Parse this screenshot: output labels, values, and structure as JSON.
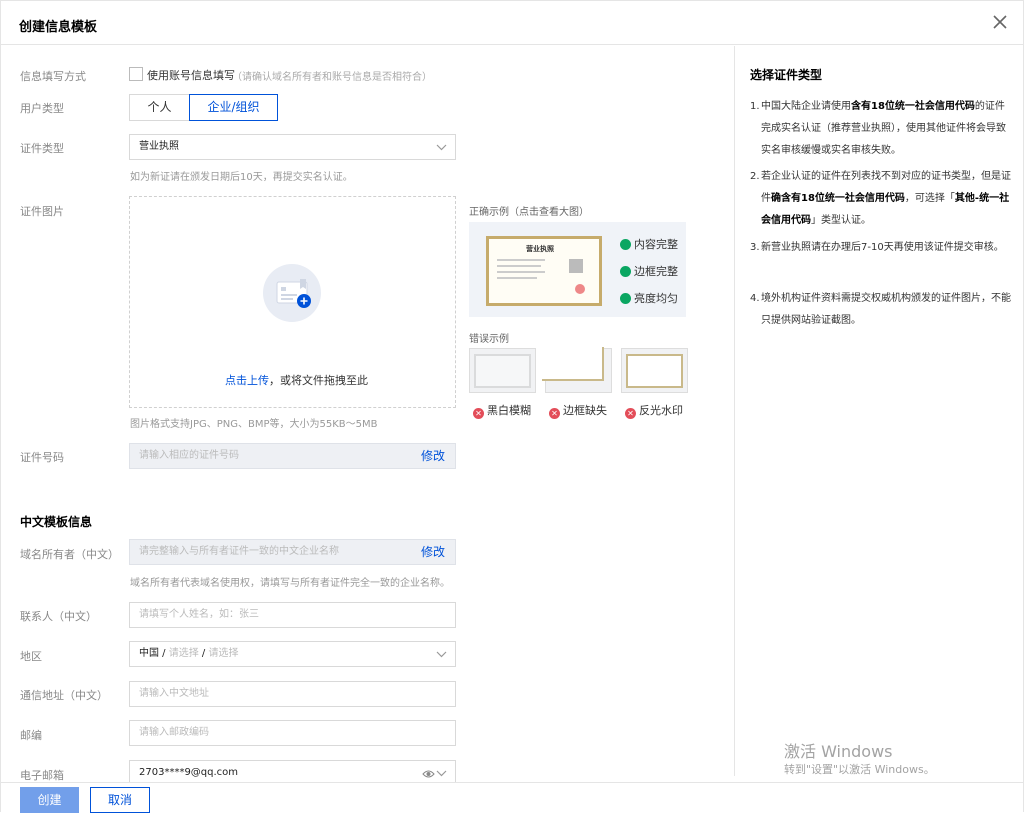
{
  "dialog": {
    "title": "创建信息模板"
  },
  "form": {
    "fill_method": {
      "label": "信息填写方式",
      "checkbox_text": "使用账号信息填写",
      "checkbox_hint": "（请确认域名所有者和账号信息是否相符合）"
    },
    "user_type": {
      "label": "用户类型",
      "options": [
        "个人",
        "企业/组织"
      ],
      "selected": "企业/组织"
    },
    "cert_type": {
      "label": "证件类型",
      "value": "营业执照",
      "hint": "如为新证请在颁发日期后10天，再提交实名认证。"
    },
    "cert_image": {
      "label": "证件图片",
      "upload_link": "点击上传",
      "upload_text": "，或将文件拖拽至此",
      "hint": "图片格式支持JPG、PNG、BMP等，大小为55KB～5MB",
      "correct_title": "正确示例（点击查看大图）",
      "correct_checks": [
        "内容完整",
        "边框完整",
        "亮度均匀"
      ],
      "wrong_title": "错误示例",
      "wrong_items": [
        "黑白模糊",
        "边框缺失",
        "反光水印"
      ],
      "sample_text": "营业执照"
    },
    "cert_number": {
      "label": "证件号码",
      "placeholder": "请输入相应的证件号码",
      "edit": "修改"
    }
  },
  "cn_section": {
    "title": "中文模板信息",
    "owner": {
      "label": "域名所有者（中文）",
      "placeholder": "请完整输入与所有者证件一致的中文企业名称",
      "edit": "修改",
      "hint": "域名所有者代表域名使用权，请填写与所有者证件完全一致的企业名称。"
    },
    "contact": {
      "label": "联系人（中文）",
      "placeholder": "请填写个人姓名，如：张三"
    },
    "region": {
      "label": "地区",
      "country": "中国",
      "sep": " / ",
      "province": "请选择",
      "city": "请选择"
    },
    "address": {
      "label": "通信地址（中文）",
      "placeholder": "请输入中文地址"
    },
    "postcode": {
      "label": "邮编",
      "placeholder": "请输入邮政编码"
    },
    "email": {
      "label": "电子邮箱",
      "value": "2703****9@qq.com"
    }
  },
  "sidebar": {
    "title": "选择证件类型",
    "items": [
      {
        "num": "1.",
        "parts": [
          {
            "t": "中国大陆企业请使用"
          },
          {
            "t": "含有18位统一社会信用代码",
            "b": true
          },
          {
            "t": "的证件完成实名认证（推荐营业执照），使用其他证件将会导致实名审核缓慢或实名审核失败。"
          }
        ]
      },
      {
        "num": "2.",
        "parts": [
          {
            "t": "若企业认证的证件在列表找不到对应的证书类型，但是证件"
          },
          {
            "t": "确含有18位统一社会信用代码",
            "b": true
          },
          {
            "t": "，可选择「"
          },
          {
            "t": "其他-统一社会信用代码",
            "b": true
          },
          {
            "t": "」类型认证。"
          }
        ]
      },
      {
        "num": "3.",
        "parts": [
          {
            "t": "新营业执照请在办理后7-10天再使用该证件提交审核。"
          }
        ]
      },
      {
        "num": "4.",
        "parts": [
          {
            "t": "境外机构证件资料需提交权威机构颁发的证件图片，不能只提供网站验证截图。"
          }
        ]
      }
    ]
  },
  "watermark": {
    "line1": "激活 Windows",
    "line2": "转到\"设置\"以激活 Windows。"
  },
  "footer": {
    "create": "创建",
    "cancel": "取消"
  },
  "colors": {
    "primary": "#0052d9",
    "success": "#0aa662",
    "error": "#e34d59"
  }
}
